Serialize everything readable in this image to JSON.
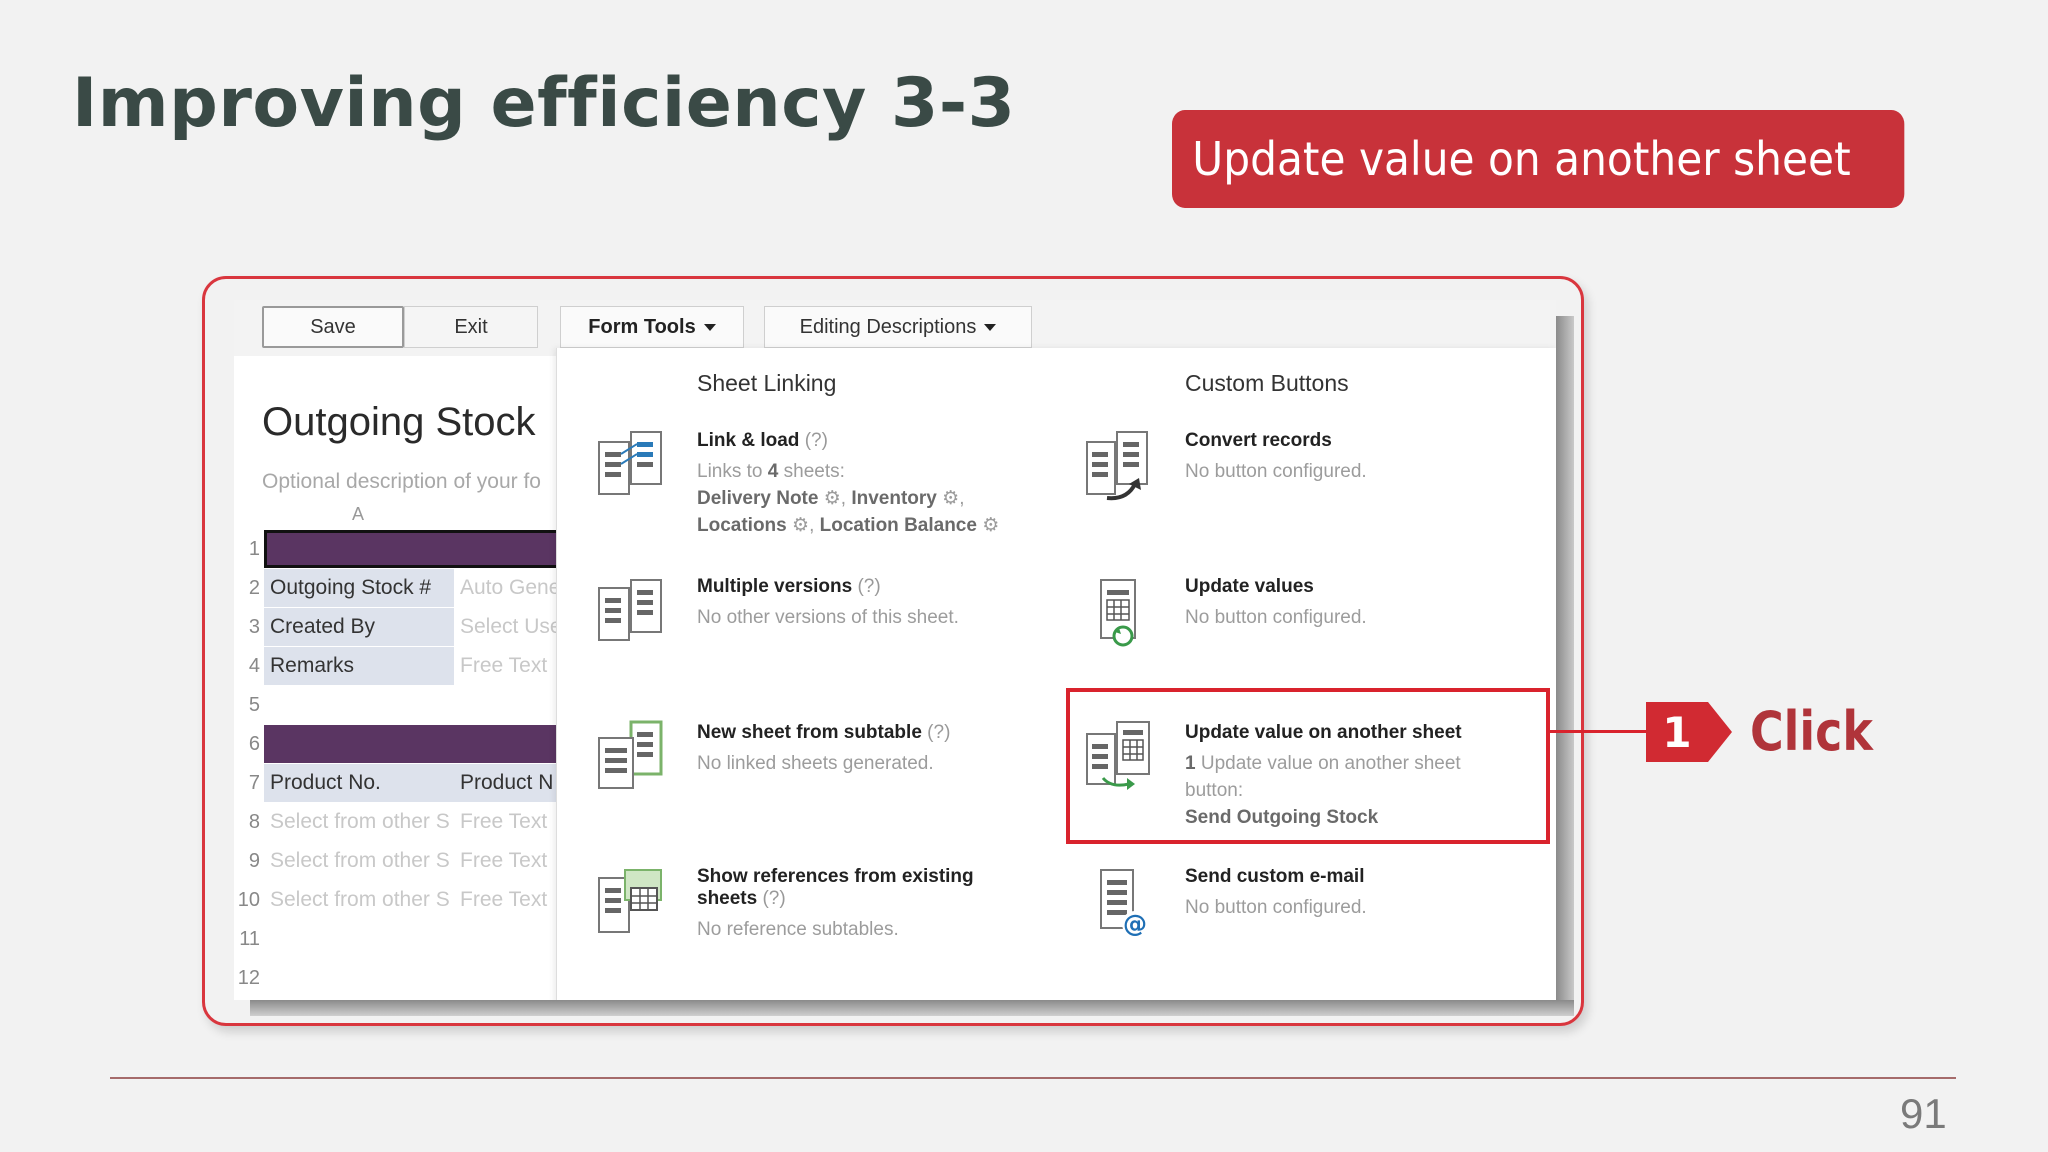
{
  "slide": {
    "title": "Improving efficiency 3-3",
    "banner": "Update value on another sheet",
    "page_number": "91",
    "step_number": "1",
    "step_action": "Click"
  },
  "toolbar": {
    "save": "Save",
    "exit": "Exit",
    "form_tools": "Form Tools",
    "editing": "Editing Descriptions"
  },
  "sheet": {
    "title": "Outgoing Stock",
    "description": "Optional description of your fo",
    "column_a": "A",
    "rows": [
      {
        "num": "1",
        "a": "",
        "b": ""
      },
      {
        "num": "2",
        "a": "Outgoing Stock #",
        "b": "Auto Gene"
      },
      {
        "num": "3",
        "a": "Created By",
        "b": "Select Use"
      },
      {
        "num": "4",
        "a": "Remarks",
        "b": "Free Text"
      },
      {
        "num": "5",
        "a": "",
        "b": ""
      },
      {
        "num": "6",
        "a": "",
        "b": ""
      },
      {
        "num": "7",
        "a": "Product No.",
        "b": "Product N"
      },
      {
        "num": "8",
        "a": "Select from other S",
        "b": "Free Text"
      },
      {
        "num": "9",
        "a": "Select from other S",
        "b": "Free Text"
      },
      {
        "num": "10",
        "a": "Select from other S",
        "b": "Free Text"
      },
      {
        "num": "11",
        "a": "",
        "b": ""
      },
      {
        "num": "12",
        "a": "",
        "b": ""
      }
    ]
  },
  "menu": {
    "sheet_linking_heading": "Sheet Linking",
    "custom_buttons_heading": "Custom Buttons",
    "link_load": {
      "title": "Link & load",
      "help": "(?)",
      "line1_pre": "Links to ",
      "line1_num": "4",
      "line1_post": " sheets:",
      "sheets": [
        "Delivery Note",
        "Inventory",
        "Locations",
        "Location Balance"
      ]
    },
    "multiple_versions": {
      "title": "Multiple versions",
      "help": "(?)",
      "sub": "No other versions of this sheet."
    },
    "new_sheet": {
      "title": "New sheet from subtable",
      "help": "(?)",
      "sub": "No linked sheets generated."
    },
    "show_refs": {
      "title1": "Show references from existing",
      "title2": "sheets",
      "help": "(?)",
      "sub": "No reference subtables."
    },
    "convert": {
      "title": "Convert records",
      "sub": "No button configured."
    },
    "update_values": {
      "title": "Update values",
      "sub": "No button configured."
    },
    "update_another": {
      "title": "Update value on another sheet",
      "count": "1",
      "sub1": " Update value on another sheet",
      "sub2": "button:",
      "button_name": "Send Outgoing Stock"
    },
    "send_email": {
      "title": "Send custom e-mail",
      "sub": "No button configured."
    }
  },
  "colors": {
    "accent_red": "#c8323a",
    "header_purple": "#5a3562",
    "label_blue": "#dde2ec"
  }
}
